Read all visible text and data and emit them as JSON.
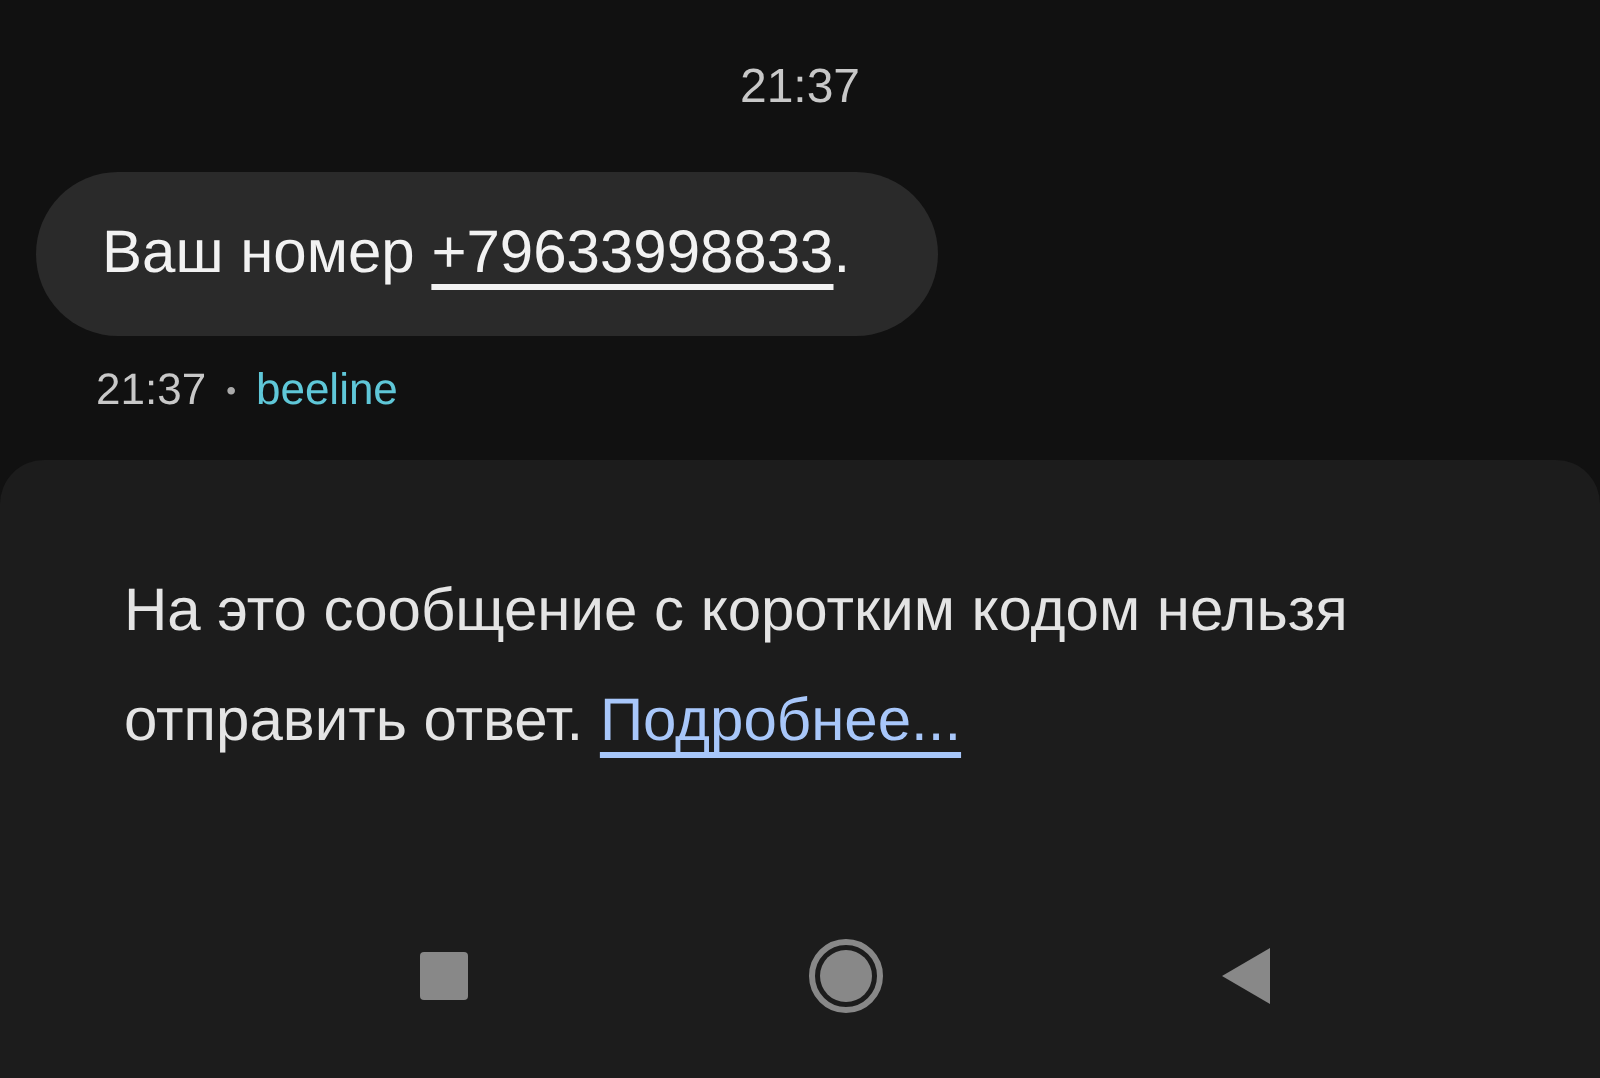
{
  "time_header": "21:37",
  "message": {
    "text_before": "Ваш номер ",
    "phone_link": "+79633998833",
    "text_after": "."
  },
  "message_meta": {
    "time": "21:37",
    "separator": "•",
    "sender": "beeline"
  },
  "reply_notice": {
    "text": "На это сообщение с коротким кодом нельзя отправить ответ.",
    "link": "Подробнее..."
  },
  "nav_bar": [
    {
      "kind": "recents"
    },
    {
      "kind": "home"
    },
    {
      "kind": "back"
    }
  ]
}
